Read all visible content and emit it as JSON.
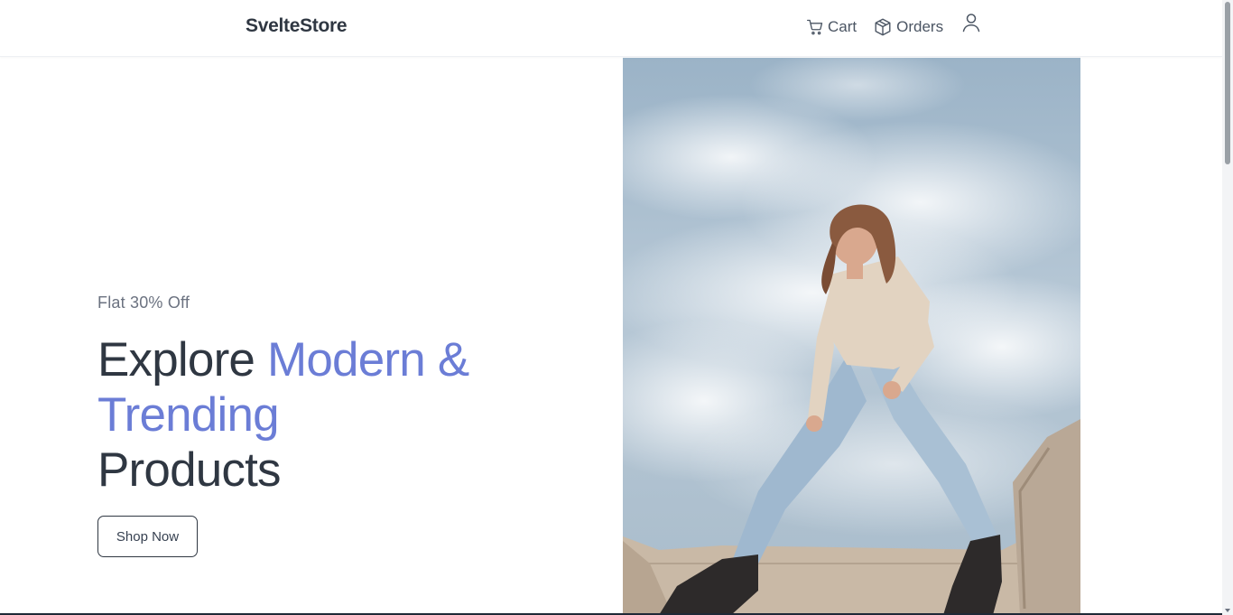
{
  "header": {
    "brand": "SvelteStore",
    "nav": {
      "cart_label": "Cart",
      "orders_label": "Orders"
    }
  },
  "hero": {
    "offer": "Flat 30% Off",
    "headline_part1": "Explore ",
    "headline_accent": "Modern & Trending",
    "headline_part2": "Products",
    "cta_label": "Shop Now"
  },
  "icons": {
    "cart": "cart-icon",
    "orders": "box-icon",
    "user": "user-icon"
  },
  "colors": {
    "accent": "#6b7dd6",
    "text_dark": "#2f3742",
    "text_muted": "#6b7280"
  }
}
